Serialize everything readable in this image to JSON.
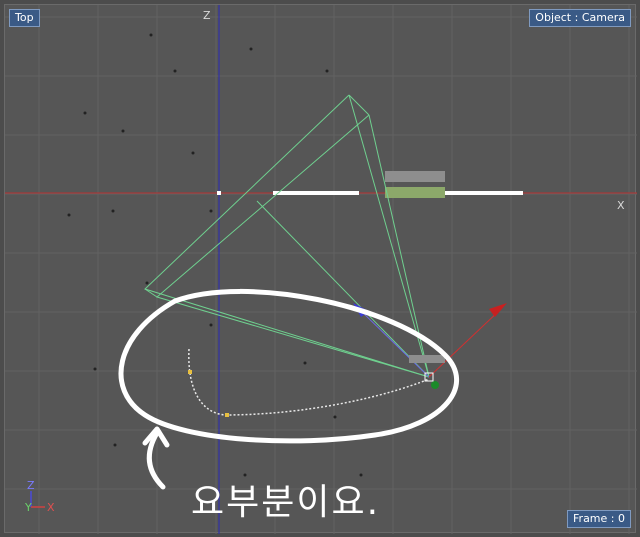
{
  "viewport": {
    "view_label": "Top",
    "object_label": "Object : Camera",
    "frame_label": "Frame : 0",
    "axis_z_letter": "Z",
    "axis_x_letter": "X",
    "gizmo_x_letter": "X",
    "gizmo_y_letter": "Y",
    "gizmo_z_letter": "Z"
  },
  "annotation": {
    "text": "요부분이요."
  },
  "colors": {
    "background": "#565656",
    "grid": "#626262",
    "x_axis": "#b83030",
    "z_axis": "#2a2ab8",
    "camera_frustum": "#6fd08f",
    "annotation": "#ffffff"
  },
  "icons": {
    "camera_object": "camera-frustum-icon",
    "axis_gizmo": "axis-gizmo-icon",
    "annotation_arrow": "curved-arrow-icon"
  }
}
